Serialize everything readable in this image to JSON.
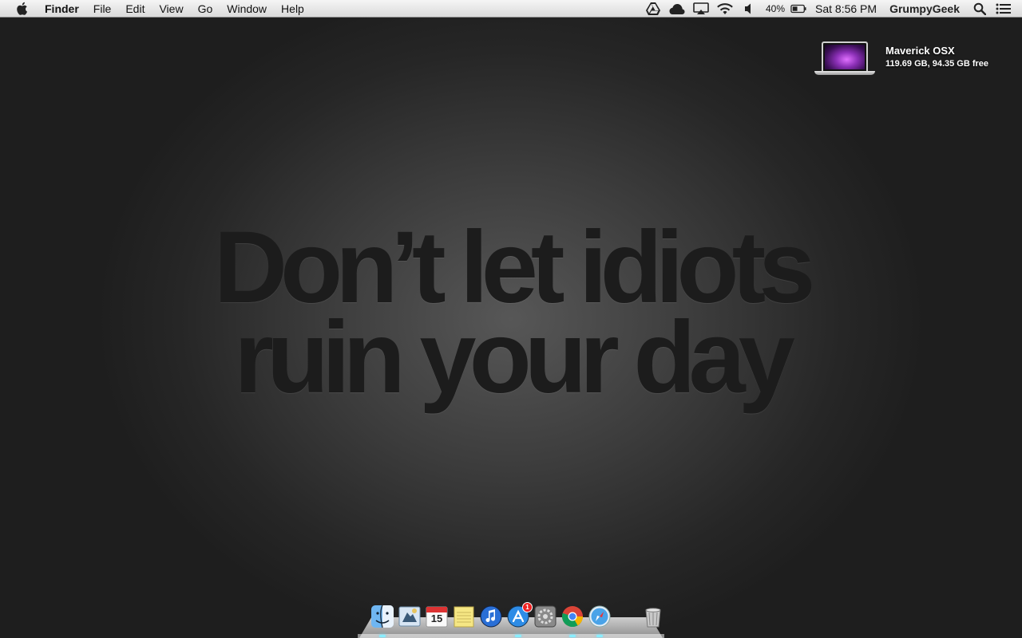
{
  "menubar": {
    "app_name": "Finder",
    "menus": [
      "File",
      "Edit",
      "View",
      "Go",
      "Window",
      "Help"
    ],
    "status": {
      "battery_percent": "40%",
      "clock": "Sat 8:56 PM",
      "user": "GrumpyGeek"
    }
  },
  "desktop": {
    "volume": {
      "name": "Maverick OSX",
      "info": "119.69 GB, 94.35 GB free"
    },
    "wallpaper_quote": {
      "line1": "Don’t let idiots",
      "line2": "ruin your day"
    }
  },
  "dock": {
    "items": [
      {
        "icon": "finder-icon",
        "running": true
      },
      {
        "icon": "mail-icon",
        "running": false
      },
      {
        "icon": "calendar-icon",
        "label": "15",
        "running": false
      },
      {
        "icon": "notes-icon",
        "running": false
      },
      {
        "icon": "itunes-icon",
        "running": false
      },
      {
        "icon": "app-store-icon",
        "badge": "1",
        "running": true
      },
      {
        "icon": "system-preferences-icon",
        "running": false
      },
      {
        "icon": "chrome-icon",
        "running": true
      },
      {
        "icon": "safari-icon",
        "running": true
      },
      {
        "icon": "trash-icon",
        "running": false
      }
    ]
  },
  "colors": {
    "accent": "#1c1c1c",
    "badge": "#e22222",
    "menubar": "#e8e8e8"
  }
}
